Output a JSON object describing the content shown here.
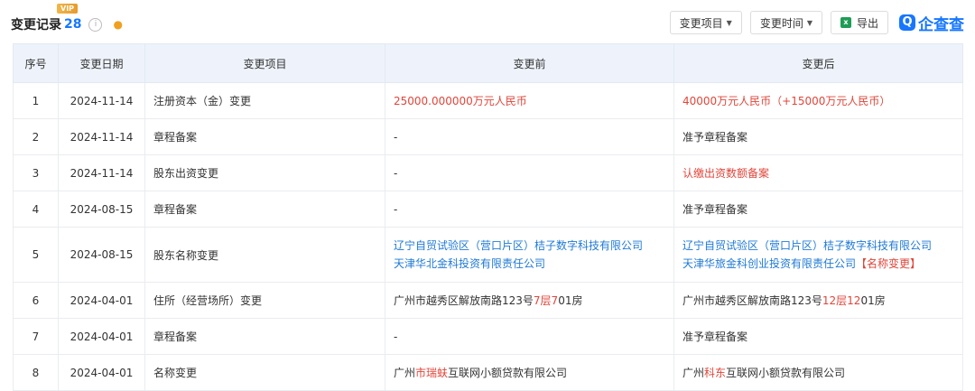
{
  "header": {
    "title": "变更记录",
    "count": "28",
    "vip": "VIP",
    "info_glyph": "i",
    "bell_glyph": "●",
    "filter_item": "变更项目",
    "filter_time": "变更时间",
    "export": "导出",
    "logo_mark": "Q",
    "logo_text": "企查查",
    "icons": [
      "info-icon",
      "bell-icon",
      "chevron-down-icon",
      "excel-icon",
      "qichacha-logo-icon"
    ]
  },
  "table": {
    "columns": [
      "序号",
      "变更日期",
      "变更项目",
      "变更前",
      "变更后"
    ],
    "rows": [
      {
        "no": "1",
        "date": "2024-11-14",
        "item": "注册资本（金）变更",
        "before": [
          [
            {
              "t": "25000.000000万元人民币",
              "c": "red"
            }
          ]
        ],
        "after": [
          [
            {
              "t": "40000万元人民币（+15000万元人民币）",
              "c": "red"
            }
          ]
        ]
      },
      {
        "no": "2",
        "date": "2024-11-14",
        "item": "章程备案",
        "before": [
          [
            {
              "t": "-",
              "c": ""
            }
          ]
        ],
        "after": [
          [
            {
              "t": "准予章程备案",
              "c": ""
            }
          ]
        ]
      },
      {
        "no": "3",
        "date": "2024-11-14",
        "item": "股东出资变更",
        "before": [
          [
            {
              "t": "-",
              "c": ""
            }
          ]
        ],
        "after": [
          [
            {
              "t": "认缴出资数额备案",
              "c": "red"
            }
          ]
        ]
      },
      {
        "no": "4",
        "date": "2024-08-15",
        "item": "章程备案",
        "before": [
          [
            {
              "t": "-",
              "c": ""
            }
          ]
        ],
        "after": [
          [
            {
              "t": "准予章程备案",
              "c": ""
            }
          ]
        ]
      },
      {
        "no": "5",
        "date": "2024-08-15",
        "item": "股东名称变更",
        "before": [
          [
            {
              "t": "辽宁自贸试验区（营口片区）桔子数字科技有限公司",
              "c": "lk"
            }
          ],
          [
            {
              "t": "天津华北金科投资有限责任公司",
              "c": "lk"
            }
          ]
        ],
        "after": [
          [
            {
              "t": "辽宁自贸试验区（营口片区）桔子数字科技有限公司",
              "c": "lk"
            }
          ],
          [
            {
              "t": "天津华旅金科创业投资有限责任公司",
              "c": "lk"
            },
            {
              "t": "【名称变更】",
              "c": "red"
            }
          ]
        ]
      },
      {
        "no": "6",
        "date": "2024-04-01",
        "item": "住所（经营场所）变更",
        "before": [
          [
            {
              "t": "广州市越秀区解放南路123号",
              "c": ""
            },
            {
              "t": "7层7",
              "c": "red"
            },
            {
              "t": "01房",
              "c": ""
            }
          ]
        ],
        "after": [
          [
            {
              "t": "广州市越秀区解放南路123号",
              "c": ""
            },
            {
              "t": "12层12",
              "c": "red"
            },
            {
              "t": "01房",
              "c": ""
            }
          ]
        ]
      },
      {
        "no": "7",
        "date": "2024-04-01",
        "item": "章程备案",
        "before": [
          [
            {
              "t": "-",
              "c": ""
            }
          ]
        ],
        "after": [
          [
            {
              "t": "准予章程备案",
              "c": ""
            }
          ]
        ]
      },
      {
        "no": "8",
        "date": "2024-04-01",
        "item": "名称变更",
        "before": [
          [
            {
              "t": "广州",
              "c": ""
            },
            {
              "t": "市瑞蚨",
              "c": "red"
            },
            {
              "t": "互联网小额贷款有限公司",
              "c": ""
            }
          ]
        ],
        "after": [
          [
            {
              "t": "广州",
              "c": ""
            },
            {
              "t": "科东",
              "c": "red"
            },
            {
              "t": "互联网小额贷款有限公司",
              "c": ""
            }
          ]
        ]
      }
    ]
  }
}
